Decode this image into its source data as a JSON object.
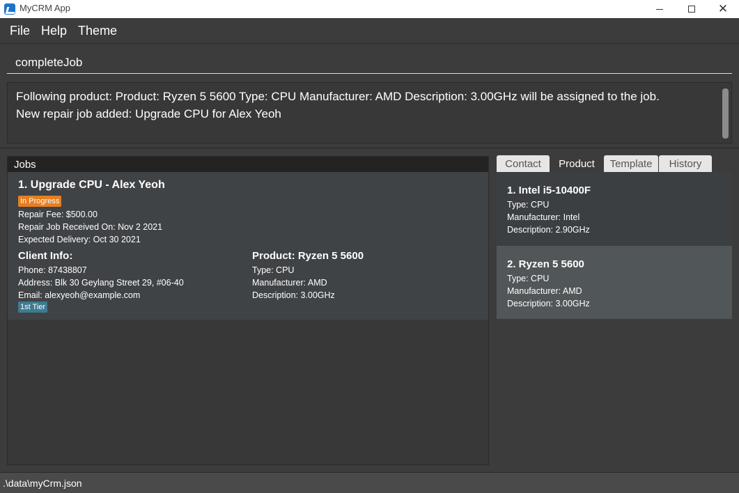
{
  "window": {
    "title": "MyCRM App",
    "controls": {
      "minimize": "—",
      "maximize": "☐",
      "close": "✕"
    }
  },
  "menu": {
    "items": [
      "File",
      "Help",
      "Theme"
    ]
  },
  "command": {
    "value": "completeJob"
  },
  "result": {
    "line1": "Following product: Product: Ryzen 5 5600 Type: CPU Manufacturer: AMD Description: 3.00GHz will be assigned to the job.",
    "line2": "New repair job added: Upgrade CPU for Alex Yeoh"
  },
  "jobs": {
    "header": "Jobs",
    "items": [
      {
        "title": "1. Upgrade CPU - Alex Yeoh",
        "status": "In Progress",
        "fee": "Repair Fee: $500.00",
        "received": "Repair Job Received On: Nov 2 2021",
        "delivery": "Expected Delivery: Oct 30 2021",
        "client_heading": "Client Info:",
        "phone": "Phone: 87438807",
        "address": "Address: Blk 30 Geylang Street 29, #06-40",
        "email": "Email: alexyeoh@example.com",
        "tier": "1st Tier",
        "product_heading": "Product: Ryzen 5 5600",
        "product_type": "Type: CPU",
        "product_manufacturer": "Manufacturer: AMD",
        "product_description": "Description: 3.00GHz"
      }
    ]
  },
  "tabs": {
    "items": [
      "Contact",
      "Product",
      "Template",
      "History"
    ],
    "active": "Product"
  },
  "products": {
    "items": [
      {
        "name": "1.  Intel i5-10400F",
        "type": "Type: CPU",
        "manufacturer": "Manufacturer: Intel",
        "description": "Description: 2.90GHz"
      },
      {
        "name": "2.  Ryzen 5 5600",
        "type": "Type: CPU",
        "manufacturer": "Manufacturer: AMD",
        "description": "Description: 3.00GHz"
      }
    ]
  },
  "status": {
    "file_path": ".\\data\\myCrm.json"
  },
  "colors": {
    "background": "#3c3c3c",
    "status_in_progress": "#e67e22",
    "tier_badge": "#3e7b91",
    "selected_product": "#515658"
  },
  "icons": {
    "app": "app-logo-icon"
  }
}
